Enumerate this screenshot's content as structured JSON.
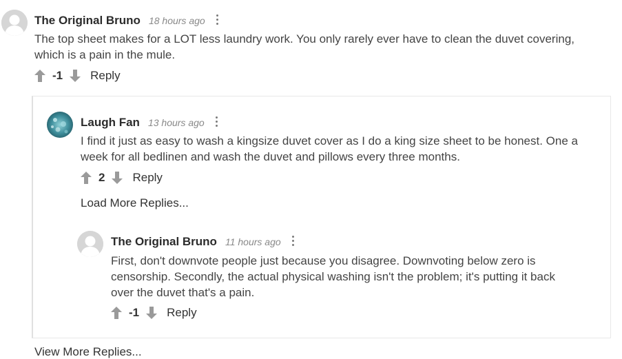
{
  "comments": [
    {
      "author": "The Original Bruno",
      "time": "18 hours ago",
      "lines": [
        "The top sheet makes for a LOT less laundry work. You only rarely ever have to clean the duvet covering,",
        "which is a pain in the mule."
      ],
      "score": "-1",
      "reply_label": "Reply",
      "avatar": "default-avatar"
    },
    {
      "author": "Laugh Fan",
      "time": "13 hours ago",
      "lines": [
        "I find it just as easy to wash a kingsize duvet cover as I do a king size sheet to be honest. One a",
        "week for all bedlinen and wash the duvet and pillows every three months."
      ],
      "score": "2",
      "reply_label": "Reply",
      "avatar": "photo-avatar"
    },
    {
      "author": "The Original Bruno",
      "time": "11 hours ago",
      "lines": [
        "First, don't downvote people just because you disagree. Downvoting below zero is",
        "censorship. Secondly, the actual physical washing isn't the problem; it's putting it back",
        "over the duvet that's a pain."
      ],
      "score": "-1",
      "reply_label": "Reply",
      "avatar": "default-avatar"
    }
  ],
  "load_more_replies": "Load More Replies...",
  "view_more_replies": "View More Replies...",
  "icons": {
    "upvote": "arrow-up-icon",
    "downvote": "arrow-down-icon",
    "menu": "kebab-menu-icon"
  },
  "colors": {
    "vote_icon": "#9a9a9a",
    "author": "#2b2b2b",
    "timestamp": "#888888"
  }
}
